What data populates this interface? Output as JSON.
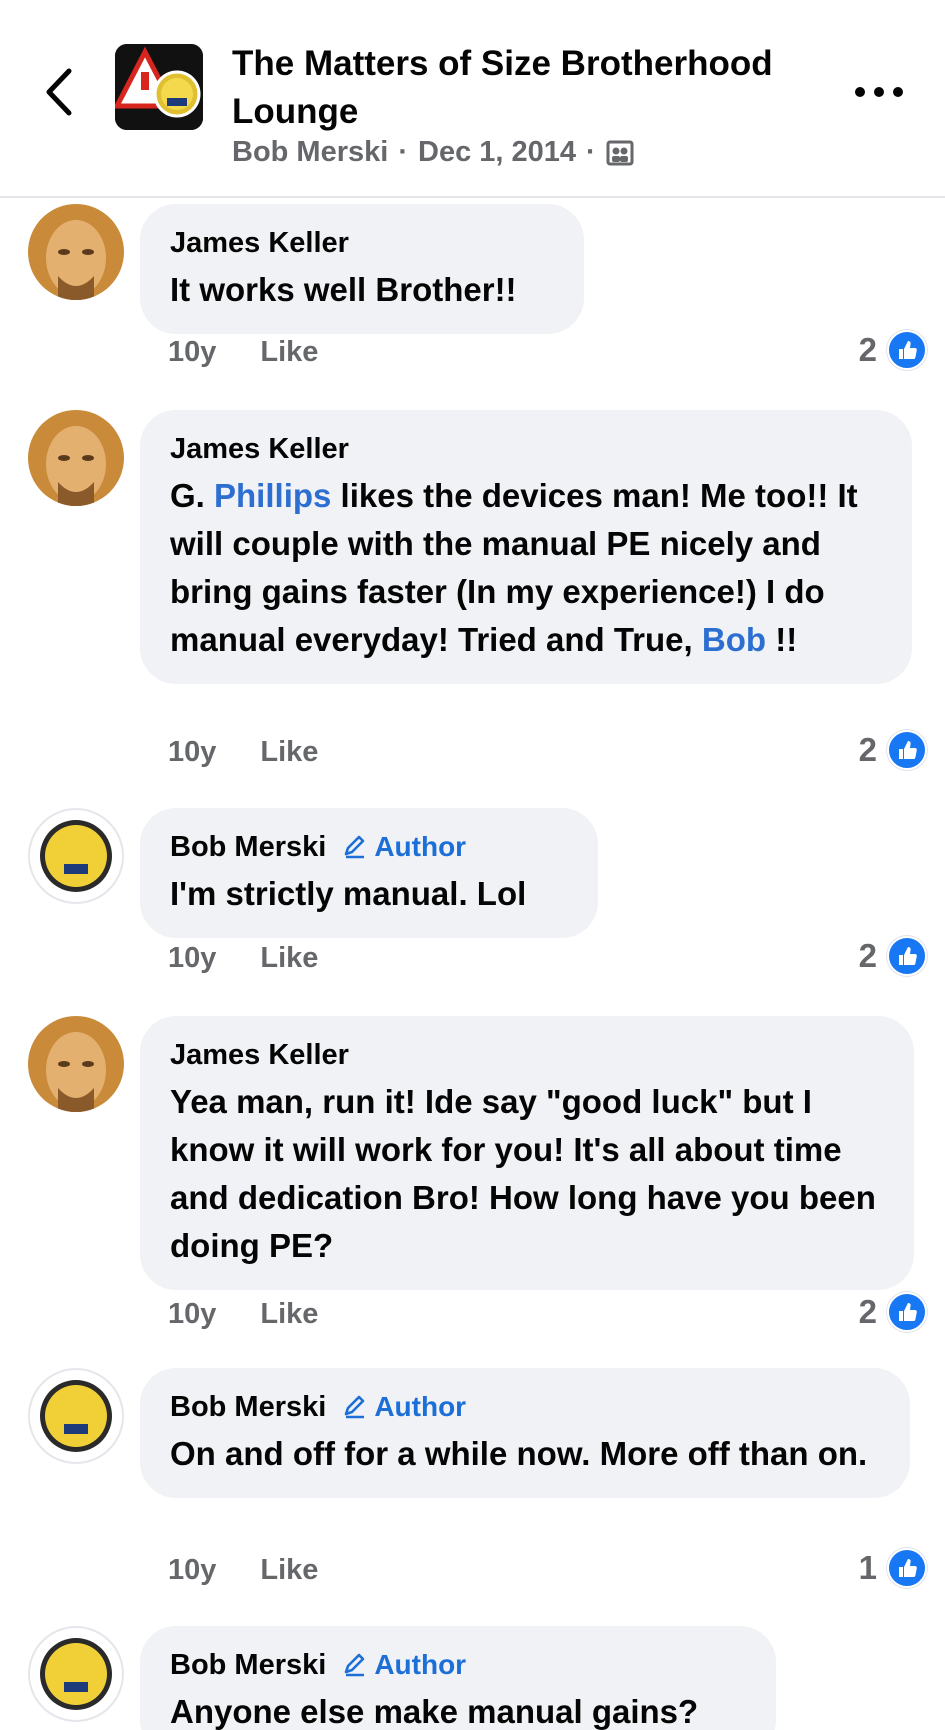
{
  "header": {
    "title": "The Matters of Size Brotherhood Lounge",
    "meta_author": "Bob Merski",
    "meta_date": "Dec 1, 2014",
    "separator": "·",
    "audience_icon": "group-audience-icon",
    "back_icon": "back-chevron-icon",
    "more_icon": "more-options-icon"
  },
  "comments": [
    {
      "author": "James Keller",
      "text": "It works well Brother!!",
      "age": "10y",
      "like_label": "Like",
      "reactions": "2"
    },
    {
      "author": "James Keller",
      "text_parts": [
        "G. ",
        "Phillips",
        " likes the devices man! Me too!! It will couple with the manual PE nicely and bring gains faster (In my experience!) I do manual everyday! Tried and True, ",
        "Bob",
        " !!"
      ],
      "age": "10y",
      "like_label": "Like",
      "reactions": "2"
    },
    {
      "author": "Bob Merski",
      "badge": "Author",
      "text": "I'm strictly manual. Lol",
      "age": "10y",
      "like_label": "Like",
      "reactions": "2"
    },
    {
      "author": "James Keller",
      "text": "Yea man, run it! Ide say \"good luck\" but I know it will work for you! It's all about time and dedication Bro! How long have you been doing PE?",
      "age": "10y",
      "like_label": "Like",
      "reactions": "2"
    },
    {
      "author": "Bob Merski",
      "badge": "Author",
      "text": "On and off for a while now. More off than on.",
      "age": "10y",
      "like_label": "Like",
      "reactions": "1"
    },
    {
      "author": "Bob Merski",
      "badge": "Author",
      "text": "Anyone else make manual gains?"
    }
  ],
  "colors": {
    "bubble": "#f0f2f5",
    "secondary_text": "#65676b",
    "link": "#2d6fd0",
    "like_blue": "#1877f2"
  }
}
